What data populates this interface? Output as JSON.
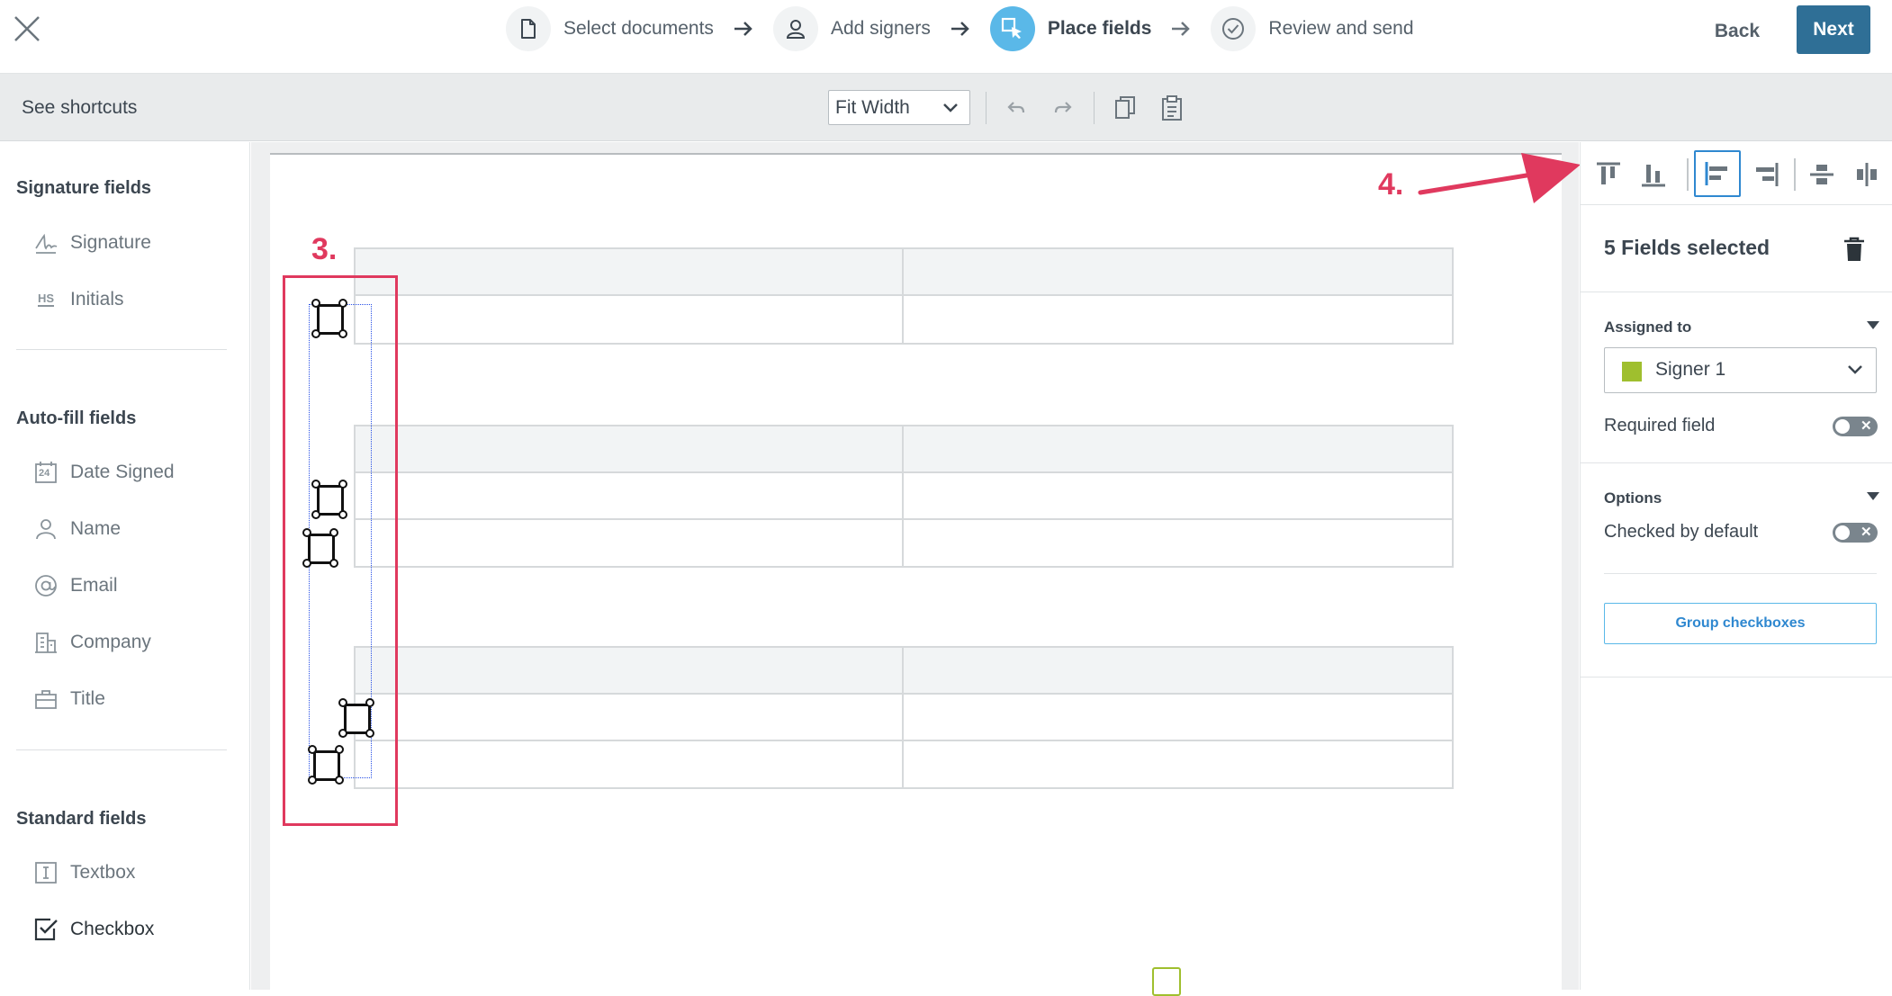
{
  "header": {
    "steps": [
      {
        "label": "Select documents",
        "icon": "document-icon"
      },
      {
        "label": "Add signers",
        "icon": "person-icon"
      },
      {
        "label": "Place fields",
        "icon": "place-cursor-icon",
        "active": true
      },
      {
        "label": "Review and send",
        "icon": "check-circle-icon"
      }
    ],
    "back_label": "Back",
    "next_label": "Next"
  },
  "toolbar": {
    "shortcuts_label": "See shortcuts",
    "zoom_value": "Fit Width"
  },
  "sidebar": {
    "signature_title": "Signature fields",
    "signature_items": [
      {
        "label": "Signature",
        "icon": "signature-icon"
      },
      {
        "label": "Initials",
        "icon": "initials-icon",
        "icon_text": "HS"
      }
    ],
    "autofill_title": "Auto-fill fields",
    "autofill_items": [
      {
        "label": "Date Signed",
        "icon": "calendar-icon",
        "icon_text": "24"
      },
      {
        "label": "Name",
        "icon": "person-icon"
      },
      {
        "label": "Email",
        "icon": "at-icon"
      },
      {
        "label": "Company",
        "icon": "building-icon"
      },
      {
        "label": "Title",
        "icon": "briefcase-icon"
      }
    ],
    "standard_title": "Standard fields",
    "standard_items": [
      {
        "label": "Textbox",
        "icon": "textbox-icon"
      },
      {
        "label": "Checkbox",
        "icon": "checkbox-icon"
      }
    ]
  },
  "annotations": {
    "step3": "3.",
    "step4": "4."
  },
  "right_panel": {
    "title": "5 Fields selected",
    "assigned_label": "Assigned to",
    "signer_name": "Signer 1",
    "signer_color": "#9fbf2e",
    "required_label": "Required field",
    "required_on": false,
    "options_label": "Options",
    "checked_default_label": "Checked by default",
    "checked_default_on": false,
    "group_button_label": "Group checkboxes"
  },
  "colors": {
    "accent": "#2f6f96",
    "active_step": "#5ab8e8",
    "annotation": "#e0395e",
    "selection": "#2850e6"
  }
}
